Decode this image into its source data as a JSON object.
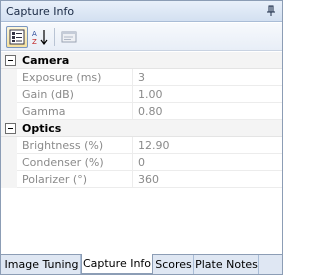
{
  "window": {
    "title": "Capture Info"
  },
  "toolbar": {
    "buttons": [
      {
        "name": "categorized",
        "icon": "categorized-view-icon",
        "active": true
      },
      {
        "name": "alphabetical",
        "icon": "sort-az-icon",
        "active": false
      },
      {
        "name": "property-pages",
        "icon": "property-pages-icon",
        "active": false
      }
    ]
  },
  "categories": [
    {
      "label": "Camera",
      "properties": [
        {
          "name": "Exposure (ms)",
          "value": "3"
        },
        {
          "name": "Gain (dB)",
          "value": "1.00"
        },
        {
          "name": "Gamma",
          "value": "0.80"
        }
      ]
    },
    {
      "label": "Optics",
      "properties": [
        {
          "name": "Brightness (%)",
          "value": "12.90"
        },
        {
          "name": "Condenser (%)",
          "value": "0"
        },
        {
          "name": "Polarizer (°)",
          "value": "360"
        }
      ]
    }
  ],
  "tabs": [
    {
      "label": "Image Tuning",
      "selected": false
    },
    {
      "label": "Capture Info",
      "selected": true
    },
    {
      "label": "Scores",
      "selected": false
    },
    {
      "label": "Plate Notes",
      "selected": false
    }
  ],
  "colors": {
    "accent": "#d3e0f1",
    "border": "#8c9db5",
    "disabled_text": "#8a8a8a"
  }
}
